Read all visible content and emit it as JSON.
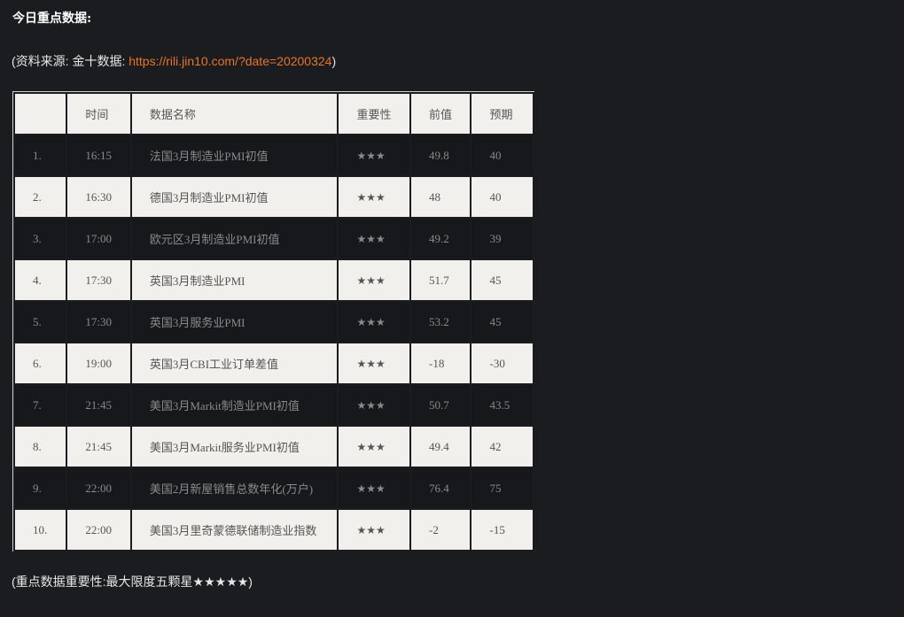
{
  "heading": "今日重点数据:",
  "source": {
    "prefix": "(资料来源: 金十数据: ",
    "link": "https://rili.jin10.com/?date=20200324",
    "suffix": ")"
  },
  "table": {
    "headers": [
      "",
      "时间",
      "数据名称",
      "重要性",
      "前值",
      "预期"
    ],
    "rows": [
      {
        "no": "1.",
        "time": "16:15",
        "name": "法国3月制造业PMI初值",
        "importance": "★★★",
        "prev": "49.8",
        "forecast": "40"
      },
      {
        "no": "2.",
        "time": "16:30",
        "name": "德国3月制造业PMI初值",
        "importance": "★★★",
        "prev": "48",
        "forecast": "40"
      },
      {
        "no": "3.",
        "time": "17:00",
        "name": "欧元区3月制造业PMI初值",
        "importance": "★★★",
        "prev": "49.2",
        "forecast": "39"
      },
      {
        "no": "4.",
        "time": "17:30",
        "name": "英国3月制造业PMI",
        "importance": "★★★",
        "prev": "51.7",
        "forecast": "45"
      },
      {
        "no": "5.",
        "time": "17:30",
        "name": "英国3月服务业PMI",
        "importance": "★★★",
        "prev": "53.2",
        "forecast": "45"
      },
      {
        "no": "6.",
        "time": "19:00",
        "name": "英国3月CBI工业订单差值",
        "importance": "★★★",
        "prev": "-18",
        "forecast": "-30"
      },
      {
        "no": "7.",
        "time": "21:45",
        "name": "美国3月Markit制造业PMI初值",
        "importance": "★★★",
        "prev": "50.7",
        "forecast": "43.5"
      },
      {
        "no": "8.",
        "time": "21:45",
        "name": "美国3月Markit服务业PMI初值",
        "importance": "★★★",
        "prev": "49.4",
        "forecast": "42"
      },
      {
        "no": "9.",
        "time": "22:00",
        "name": "美国2月新屋销售总数年化(万户)",
        "importance": "★★★",
        "prev": "76.4",
        "forecast": "75"
      },
      {
        "no": "10.",
        "time": "22:00",
        "name": "美国3月里奇蒙德联储制造业指数",
        "importance": "★★★",
        "prev": "-2",
        "forecast": "-15"
      }
    ]
  },
  "footnote": "(重点数据重要性:最大限度五颗星★★★★★)",
  "colors": {
    "background": "#1b1c20",
    "light_row": "#f1f0ec",
    "dark_row": "#17181c",
    "link": "#e8742a"
  }
}
